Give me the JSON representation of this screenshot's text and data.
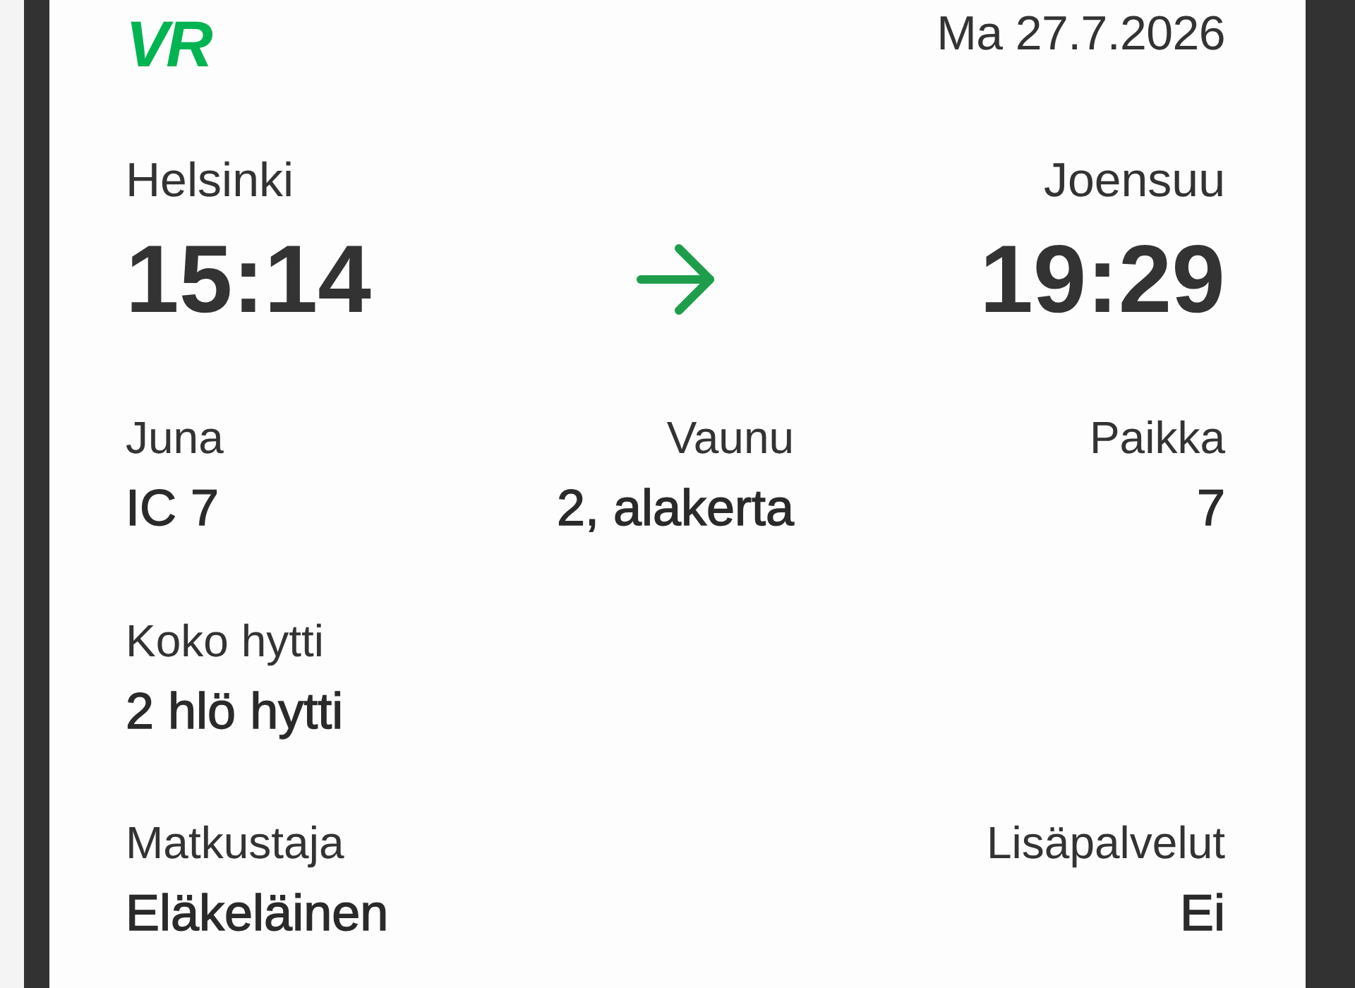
{
  "header": {
    "logo": "VR",
    "date": "Ma 27.7.2026"
  },
  "journey": {
    "origin": {
      "station": "Helsinki",
      "time": "15:14"
    },
    "destination": {
      "station": "Joensuu",
      "time": "19:29"
    }
  },
  "rows": [
    {
      "fields": [
        {
          "label": "Juna",
          "value": "IC 7"
        },
        {
          "label": "Vaunu",
          "value": "2, alakerta"
        },
        {
          "label": "Paikka",
          "value": "7"
        }
      ]
    },
    {
      "fields": [
        {
          "label": "Koko hytti",
          "value": "2 hlö hytti"
        }
      ]
    },
    {
      "fields": [
        {
          "label": "Matkustaja",
          "value": "Eläkeläinen"
        },
        {
          "label": "Lisäpalvelut",
          "value": "Ei"
        }
      ]
    }
  ]
}
